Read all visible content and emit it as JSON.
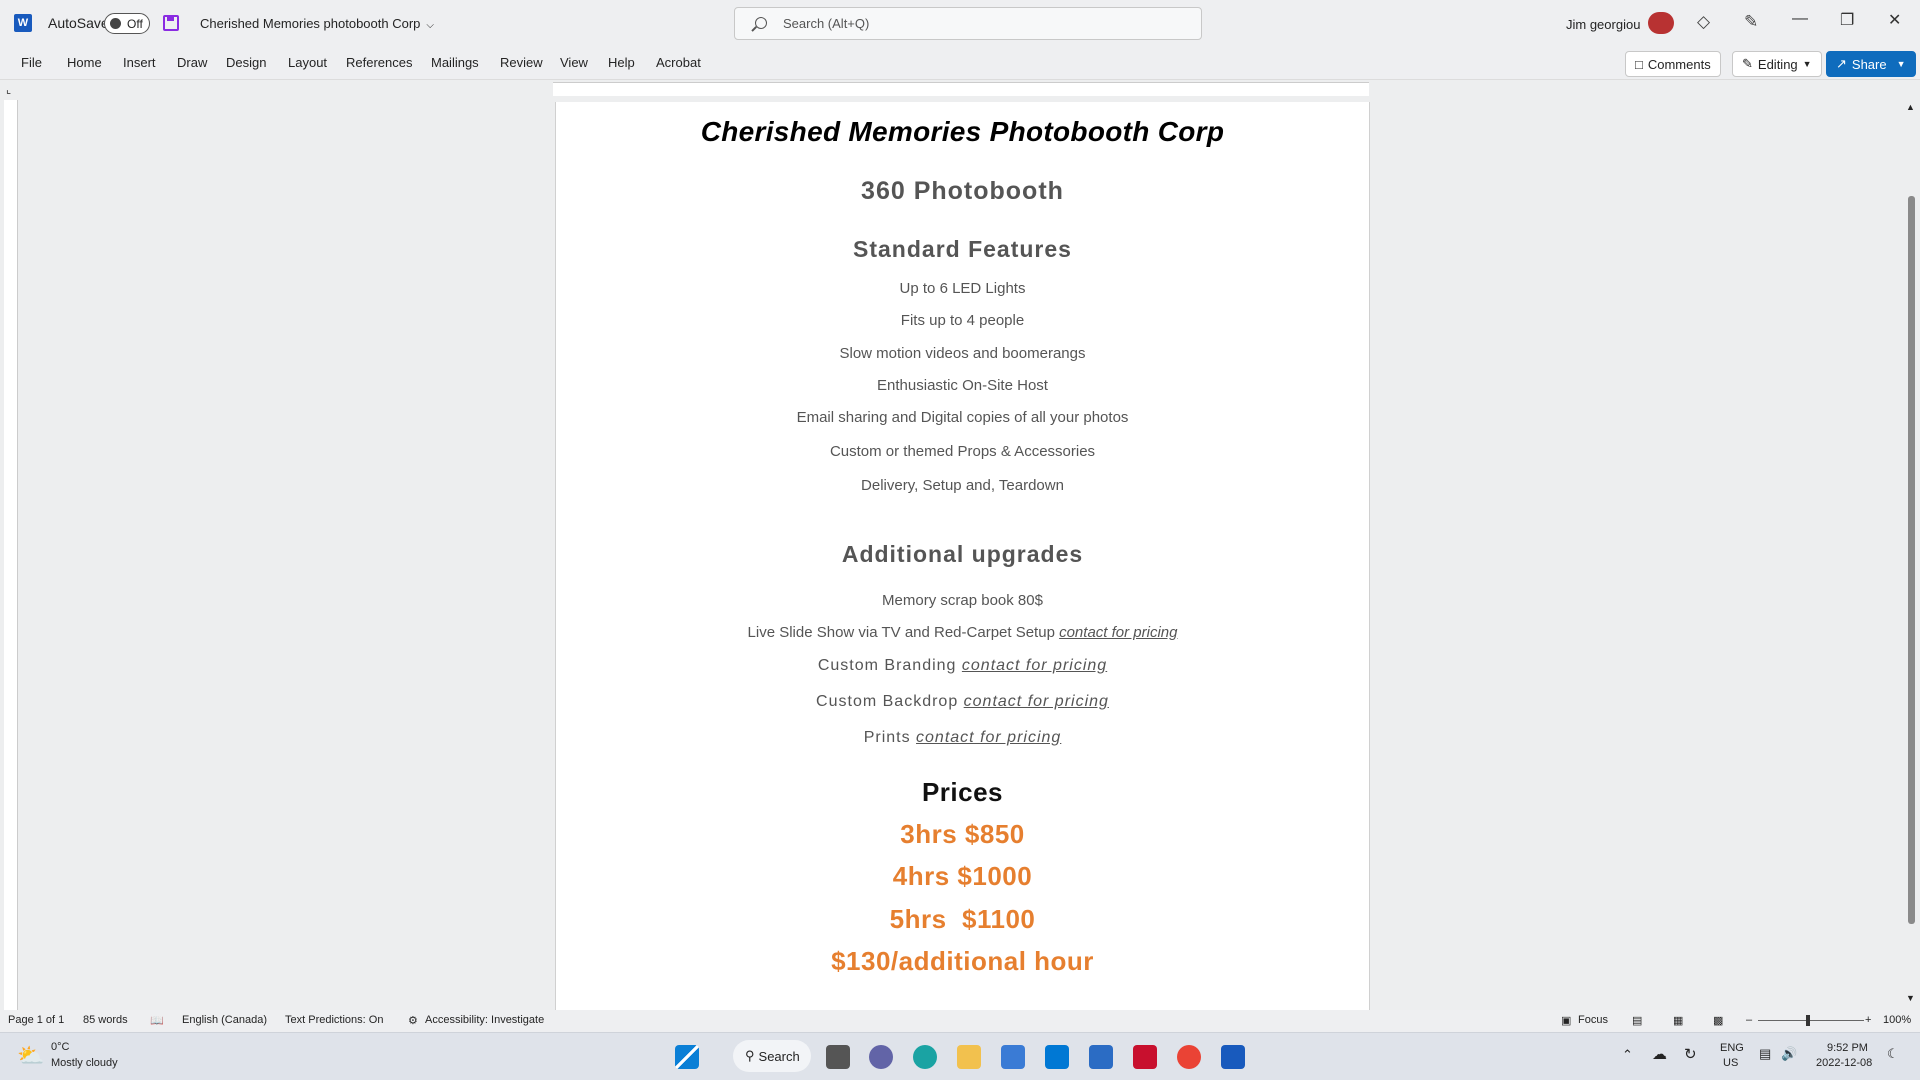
{
  "titlebar": {
    "app_icon": "word-icon",
    "autosave_label": "AutoSave",
    "autosave_state": "Off",
    "document_title": "Cherished Memories photobooth Corp",
    "search_placeholder": "Search (Alt+Q)",
    "user_name": "Jim georgiou"
  },
  "menu": [
    "File",
    "Home",
    "Insert",
    "Draw",
    "Design",
    "Layout",
    "References",
    "Mailings",
    "Review",
    "View",
    "Help",
    "Acrobat"
  ],
  "ribbon_right": {
    "comments": "Comments",
    "editing": "Editing",
    "share": "Share"
  },
  "document": {
    "company": "Cherished Memories Photobooth Corp",
    "product": "360 Photobooth",
    "features_heading": "Standard Features",
    "features": [
      "Up to 6 LED Lights",
      "Fits up to 4 people",
      "Slow motion videos and boomerangs",
      "Enthusiastic On-Site Host",
      "Email sharing and Digital copies of all your photos",
      "Custom or themed Props & Accessories",
      "Delivery, Setup and, Teardown"
    ],
    "upgrades_heading": "Additional upgrades",
    "upgrade_1": "Memory scrap book 80$",
    "upgrade_2_text": "Live Slide Show via TV and Red-Carpet Setup ",
    "upgrade_3_text": "Custom Branding ",
    "upgrade_4_text": "Custom Backdrop ",
    "upgrade_5_text": "Prints ",
    "pricing_link": "contact for pricing",
    "prices_heading": "Prices",
    "prices": [
      "3hrs $850",
      "4hrs $1000",
      "5hrs  $1100",
      "$130/additional hour"
    ],
    "price_color": "#e67f2f"
  },
  "statusbar": {
    "page": "Page 1 of 1",
    "words": "85 words",
    "language": "English (Canada)",
    "predictions": "Text Predictions: On",
    "accessibility": "Accessibility: Investigate",
    "focus": "Focus",
    "zoom": "100%"
  },
  "taskbar": {
    "temp": "0°C",
    "weather": "Mostly cloudy",
    "search": "Search",
    "lang": "ENG",
    "region": "US",
    "time": "9:52 PM",
    "date": "2022-12-08"
  }
}
